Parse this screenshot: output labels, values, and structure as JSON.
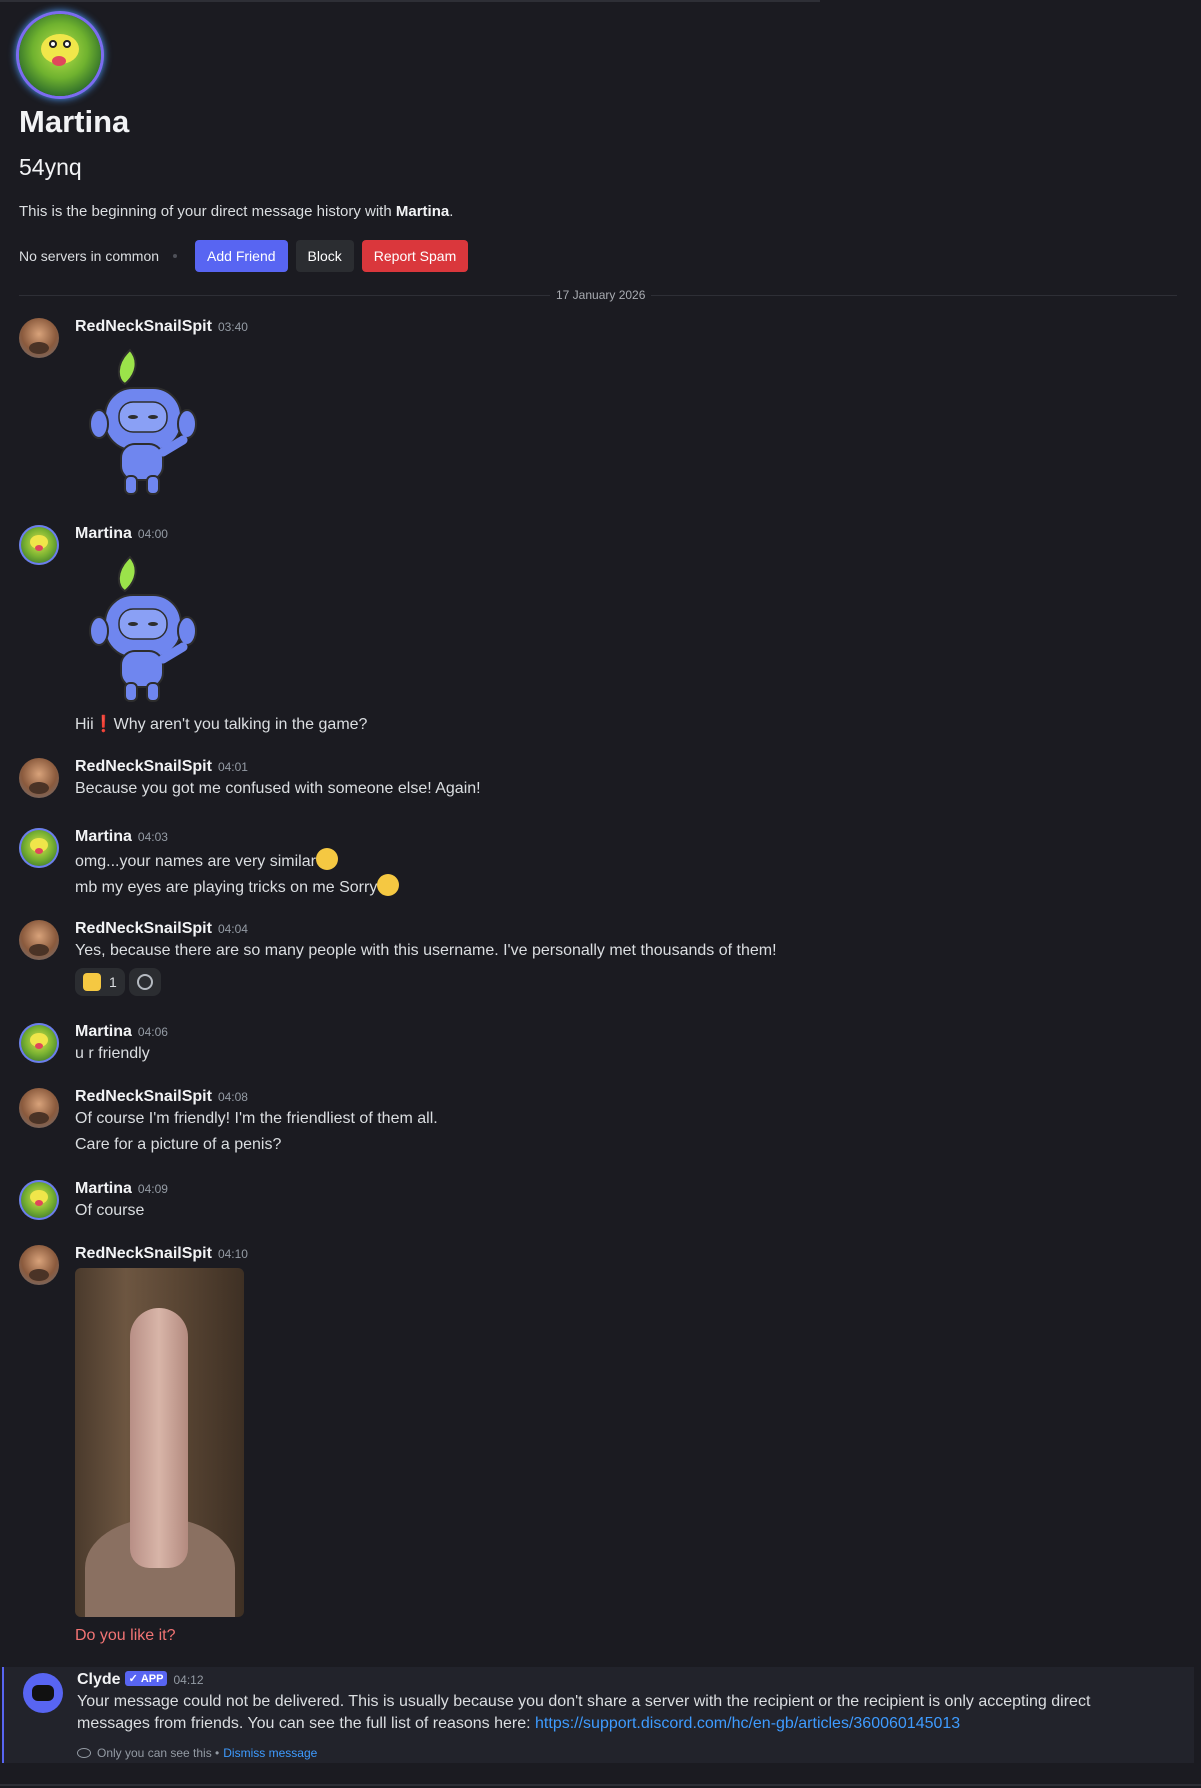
{
  "profile": {
    "display_name": "Martina",
    "username": "54ynq",
    "intro_prefix": "This is the beginning of your direct message history with ",
    "intro_name": "Martina",
    "intro_suffix": ".",
    "no_servers": "No servers in common",
    "add_friend": "Add Friend",
    "block": "Block",
    "report_spam": "Report Spam"
  },
  "date_divider": "17 January 2026",
  "messages": {
    "m1": {
      "author": "RedNeckSnailSpit",
      "time": "03:40"
    },
    "m2": {
      "author": "Martina",
      "time": "04:00",
      "text": "Hii❗Why aren't you talking in the game?"
    },
    "m3": {
      "author": "RedNeckSnailSpit",
      "time": "04:01",
      "text": "Because you got me confused with someone else! Again!"
    },
    "m4": {
      "author": "Martina",
      "time": "04:03",
      "line1": "omg...your names are very similar",
      "line2": "mb my eyes are playing tricks on me Sorry"
    },
    "m5": {
      "author": "RedNeckSnailSpit",
      "time": "04:04",
      "text": "Yes, because there are so many people with this username. I've personally met thousands of them!",
      "reaction_count": "1"
    },
    "m6": {
      "author": "Martina",
      "time": "04:06",
      "text": "u r friendly"
    },
    "m7": {
      "author": "RedNeckSnailSpit",
      "time": "04:08",
      "line1": "Of course I'm friendly! I'm the friendliest of them all.",
      "line2": "Care for a picture of a penis?"
    },
    "m8": {
      "author": "Martina",
      "time": "04:09",
      "text": "Of course"
    },
    "m9": {
      "author": "RedNeckSnailSpit",
      "time": "04:10",
      "text": "Do you like it?"
    }
  },
  "clyde": {
    "author": "Clyde",
    "badge": "APP",
    "time": "04:12",
    "text": "Your message could not be delivered. This is usually because you don't share a server with the recipient or the recipient is only accepting direct messages from friends. You can see the full list of reasons here: ",
    "link": "https://support.discord.com/hc/en-gb/articles/360060145013",
    "only_you": "Only you can see this •",
    "dismiss": "Dismiss message"
  },
  "colors": {
    "accent": "#5865f2",
    "danger": "#da373c",
    "link": "#3e9bff",
    "background": "#1b1b21"
  }
}
